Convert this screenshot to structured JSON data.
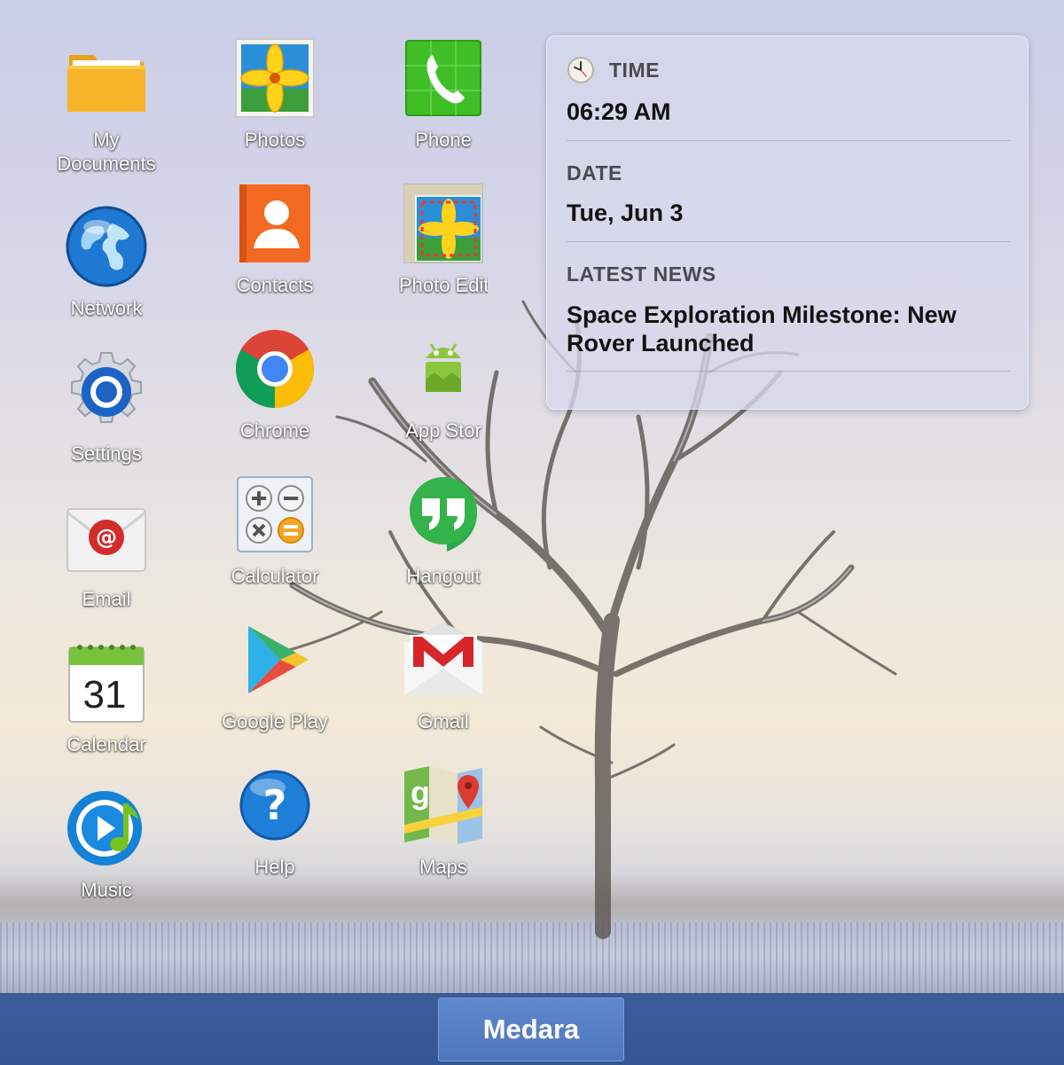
{
  "apps": [
    {
      "label": "My\nDocuments",
      "icon": "folder-icon"
    },
    {
      "label": "Photos",
      "icon": "photos-icon"
    },
    {
      "label": "Phone",
      "icon": "phone-icon"
    },
    {
      "label": "Network",
      "icon": "globe-icon"
    },
    {
      "label": "Contacts",
      "icon": "contacts-icon"
    },
    {
      "label": "Photo Edit",
      "icon": "photo-edit-icon"
    },
    {
      "label": "Settings",
      "icon": "gear-icon"
    },
    {
      "label": "Chrome",
      "icon": "chrome-icon"
    },
    {
      "label": "App Stor",
      "icon": "android-icon"
    },
    {
      "label": "Email",
      "icon": "email-icon"
    },
    {
      "label": "Calculator",
      "icon": "calculator-icon"
    },
    {
      "label": "Hangout",
      "icon": "hangouts-icon"
    },
    {
      "label": "Calendar",
      "icon": "calendar-icon",
      "badge": "31"
    },
    {
      "label": "Google Play",
      "icon": "play-store-icon"
    },
    {
      "label": "Gmail",
      "icon": "gmail-icon"
    },
    {
      "label": "Music",
      "icon": "music-icon"
    },
    {
      "label": "Help",
      "icon": "help-icon"
    },
    {
      "label": "Maps",
      "icon": "maps-icon"
    }
  ],
  "widget": {
    "time_heading": "TIME",
    "time_value": "06:29 AM",
    "date_heading": "DATE",
    "date_value": "Tue, Jun 3",
    "news_heading": "LATEST NEWS",
    "news_value": "Space Exploration Milestone: New Rover Launched"
  },
  "taskbar": {
    "start_label": "Medara"
  },
  "colors": {
    "taskbar": "#3b5d9c",
    "start_button": "#5a82c6",
    "widget_bg": "#d6d8ec"
  }
}
